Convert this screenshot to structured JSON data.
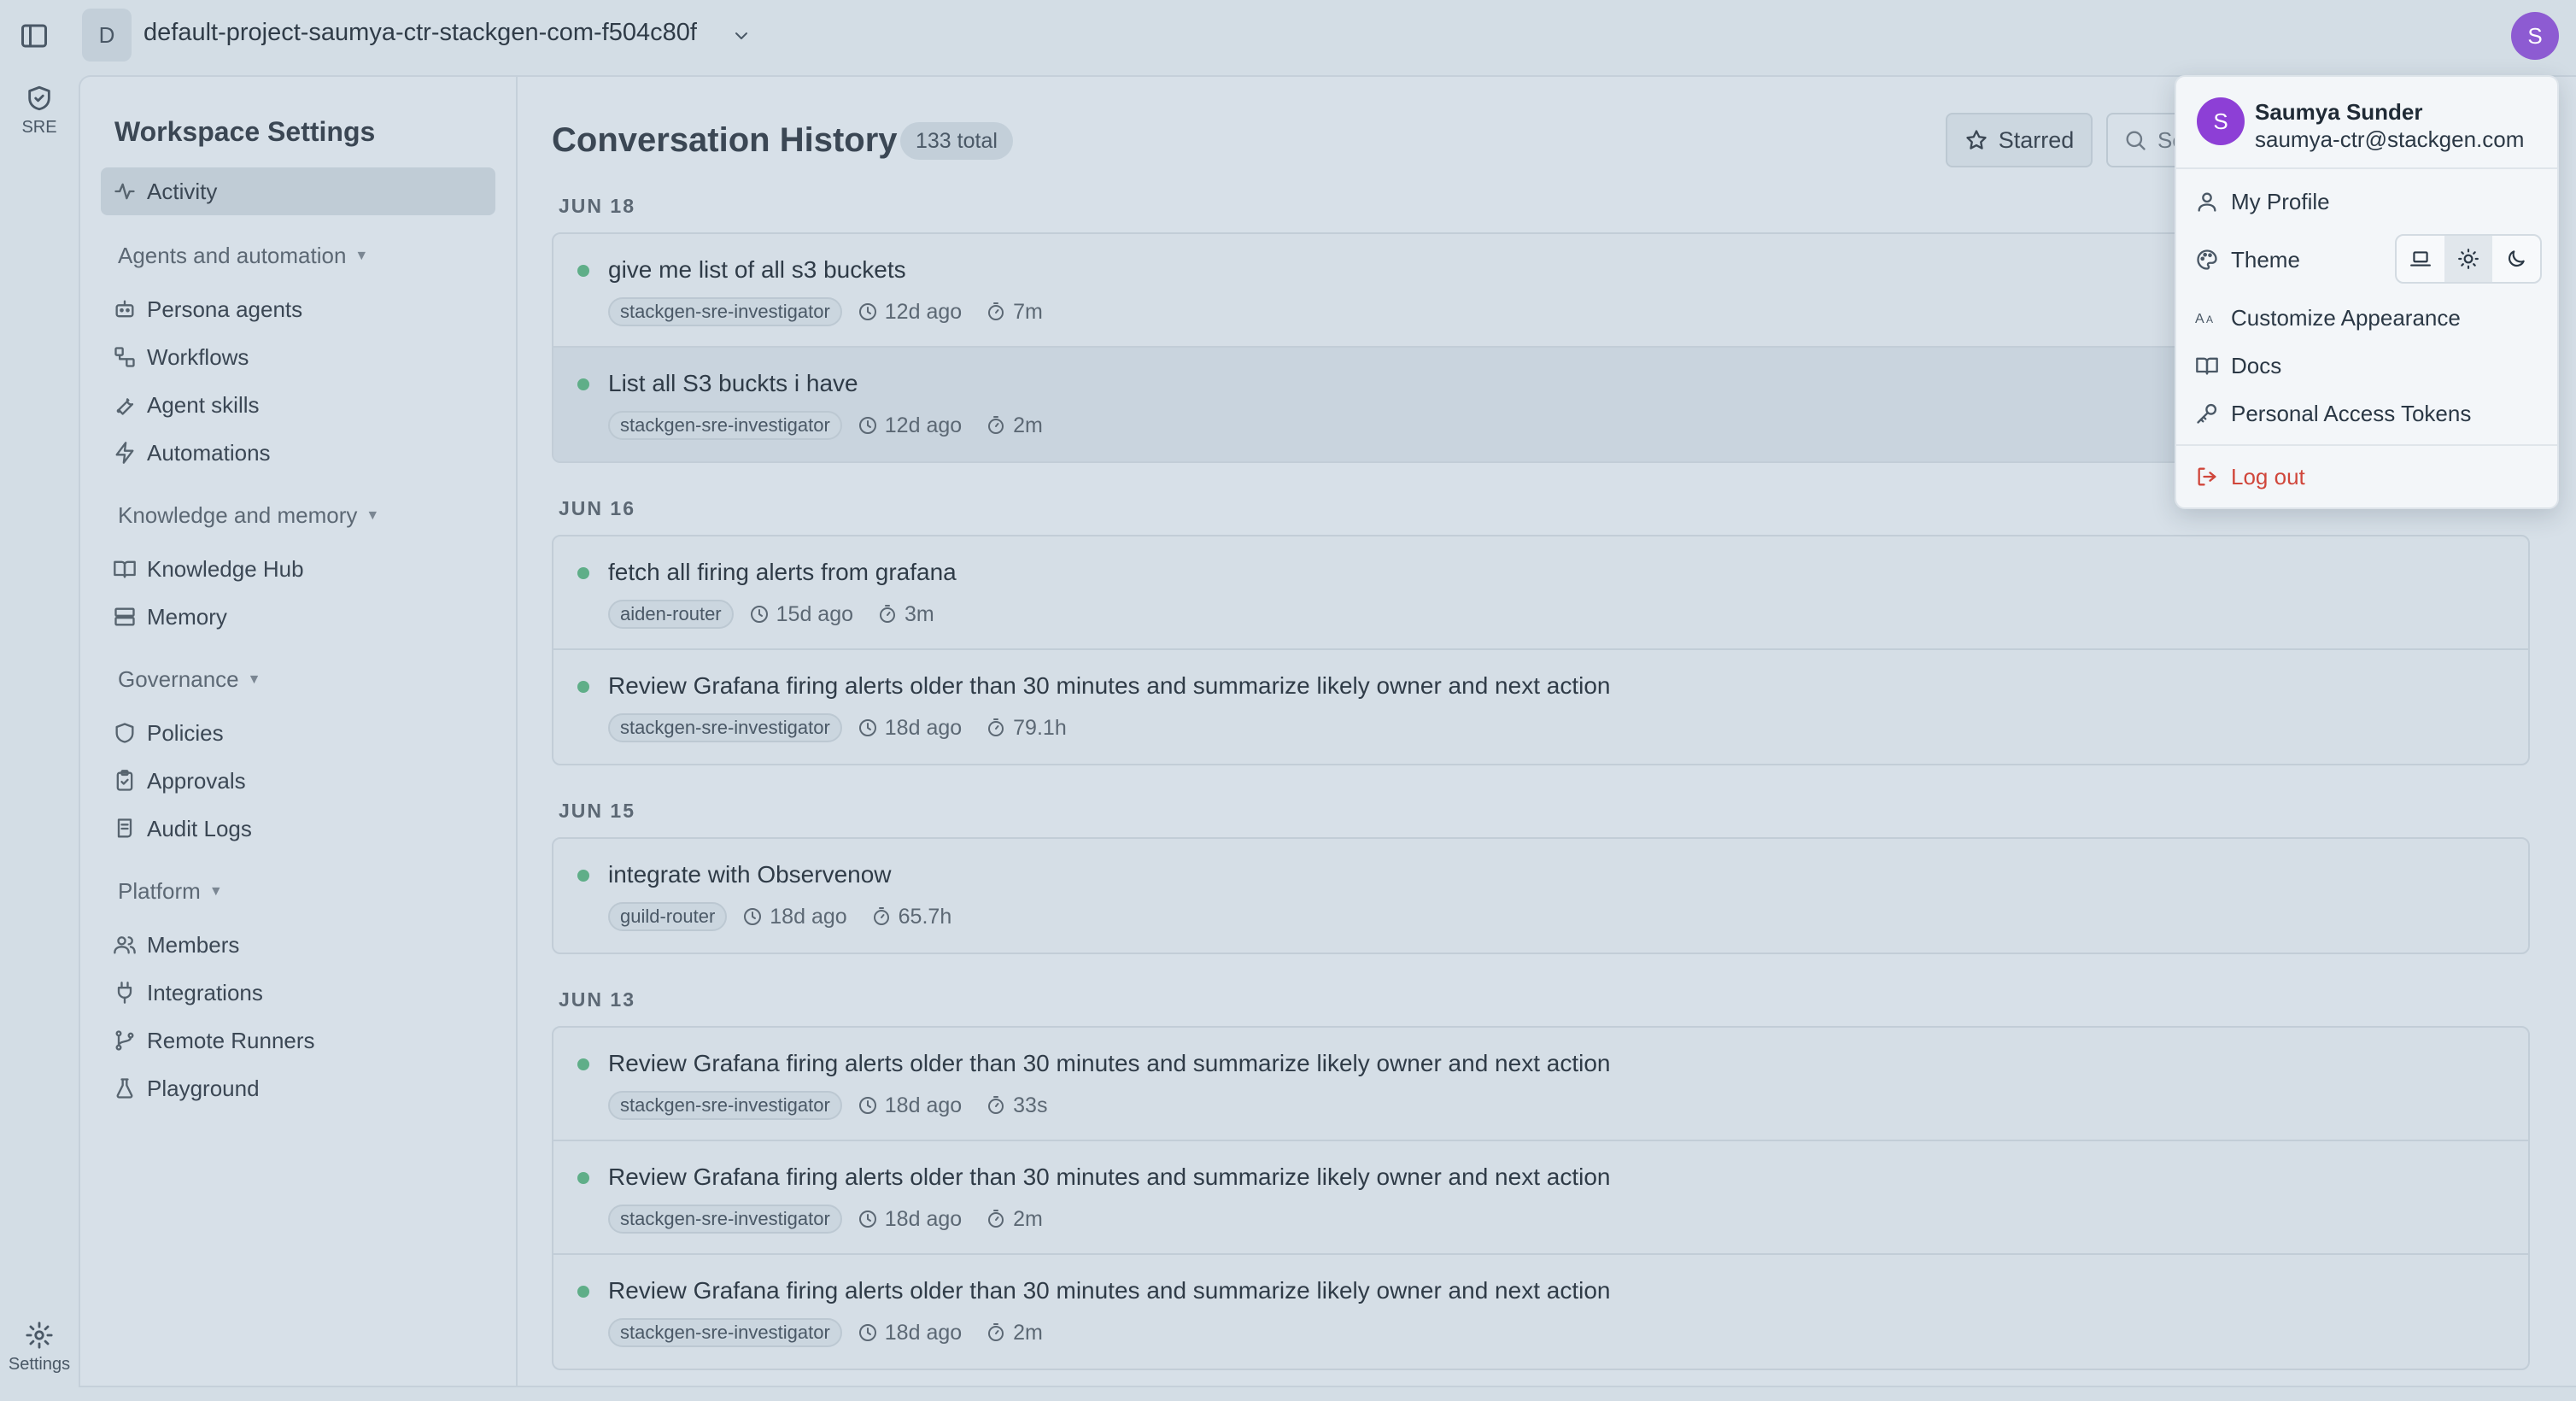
{
  "project": {
    "badge": "D",
    "name": "default-project-saumya-ctr-stackgen-com-f504c80f"
  },
  "user_avatar": "S",
  "rail": {
    "top_label": "SRE",
    "bottom_label": "Settings"
  },
  "settings_sidebar": {
    "title": "Workspace Settings",
    "activity": "Activity",
    "groups": {
      "agents": "Agents and automation",
      "knowledge": "Knowledge and memory",
      "governance": "Governance",
      "platform": "Platform"
    },
    "items": {
      "persona_agents": "Persona agents",
      "workflows": "Workflows",
      "agent_skills": "Agent skills",
      "automations": "Automations",
      "knowledge_hub": "Knowledge Hub",
      "memory": "Memory",
      "policies": "Policies",
      "approvals": "Approvals",
      "audit_logs": "Audit Logs",
      "members": "Members",
      "integrations": "Integrations",
      "remote_runners": "Remote Runners",
      "playground": "Playground"
    }
  },
  "content": {
    "title": "Conversation History",
    "total_badge": "133 total",
    "starred_label": "Starred",
    "search_placeholder": "Search"
  },
  "conversations": [
    {
      "date": "JUN 18",
      "items": [
        {
          "title": "give me list of all s3 buckets",
          "agent": "stackgen-sre-investigator",
          "ago": "12d ago",
          "duration": "7m"
        },
        {
          "title": "List all S3 buckts i have",
          "agent": "stackgen-sre-investigator",
          "ago": "12d ago",
          "duration": "2m"
        }
      ]
    },
    {
      "date": "JUN 16",
      "items": [
        {
          "title": "fetch all firing alerts from grafana",
          "agent": "aiden-router",
          "ago": "15d ago",
          "duration": "3m"
        },
        {
          "title": "Review Grafana firing alerts older than 30 minutes and summarize likely owner and next action",
          "agent": "stackgen-sre-investigator",
          "ago": "18d ago",
          "duration": "79.1h"
        }
      ]
    },
    {
      "date": "JUN 15",
      "items": [
        {
          "title": "integrate with Observenow",
          "agent": "guild-router",
          "ago": "18d ago",
          "duration": "65.7h"
        }
      ]
    },
    {
      "date": "JUN 13",
      "items": [
        {
          "title": "Review Grafana firing alerts older than 30 minutes and summarize likely owner and next action",
          "agent": "stackgen-sre-investigator",
          "ago": "18d ago",
          "duration": "33s"
        },
        {
          "title": "Review Grafana firing alerts older than 30 minutes and summarize likely owner and next action",
          "agent": "stackgen-sre-investigator",
          "ago": "18d ago",
          "duration": "2m"
        },
        {
          "title": "Review Grafana firing alerts older than 30 minutes and summarize likely owner and next action",
          "agent": "stackgen-sre-investigator",
          "ago": "18d ago",
          "duration": "2m"
        }
      ]
    }
  ],
  "user_menu": {
    "avatar": "S",
    "name": "Saumya Sunder",
    "email": "saumya-ctr@stackgen.com",
    "my_profile": "My Profile",
    "theme": "Theme",
    "theme_selected": "light",
    "customize": "Customize Appearance",
    "docs": "Docs",
    "tokens": "Personal Access Tokens",
    "logout": "Log out"
  },
  "colors": {
    "status_dot": "#5fae88",
    "avatar": "#8d5bd2",
    "logout": "#d0463b"
  }
}
